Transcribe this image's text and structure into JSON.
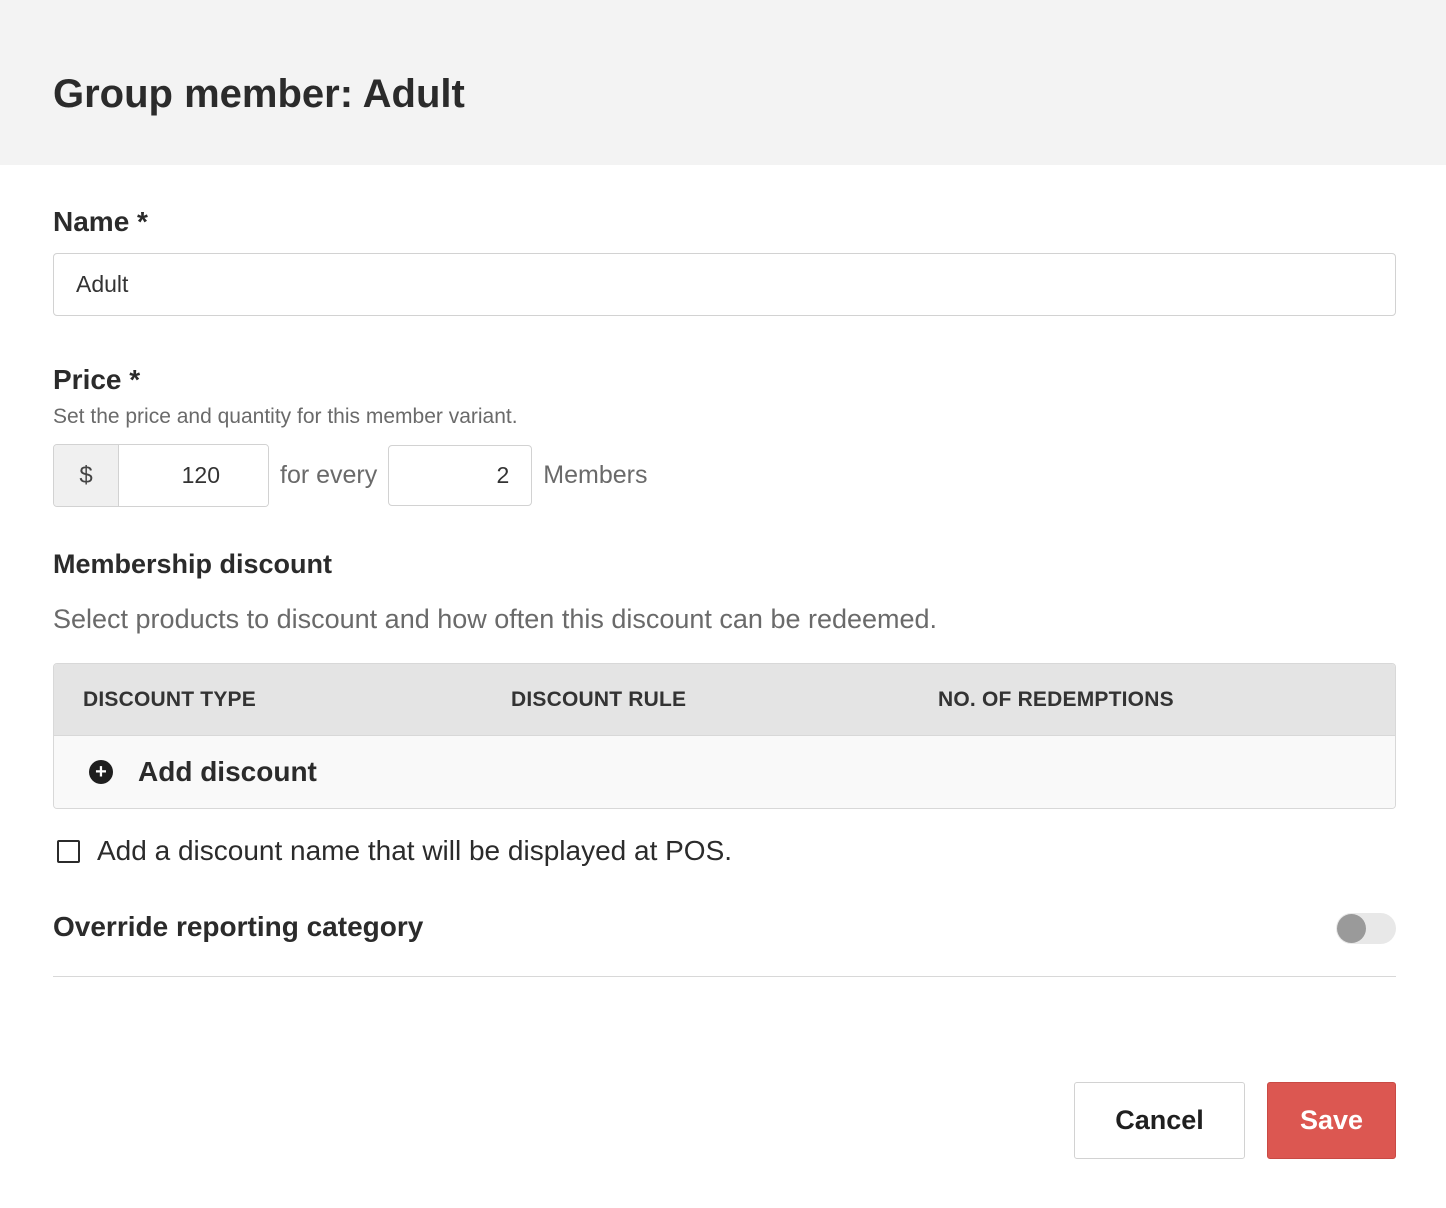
{
  "header": {
    "title": "Group member: Adult"
  },
  "name_field": {
    "label": "Name *",
    "value": "Adult"
  },
  "price": {
    "label": "Price *",
    "help": "Set the price and quantity for this member variant.",
    "currency_symbol": "$",
    "amount": "120",
    "connector": "for every",
    "quantity": "2",
    "unit": "Members"
  },
  "membership_discount": {
    "title": "Membership discount",
    "help": "Select products to discount and how often this discount can be redeemed.",
    "columns": [
      "DISCOUNT TYPE",
      "DISCOUNT RULE",
      "NO. OF REDEMPTIONS"
    ],
    "add_label": "Add discount",
    "add_icon": "plus-circle-icon"
  },
  "pos_name_option": {
    "label": "Add a discount name that will be displayed at POS.",
    "checked": false
  },
  "override_reporting": {
    "label": "Override reporting category",
    "enabled": false
  },
  "actions": {
    "cancel": "Cancel",
    "save": "Save"
  },
  "colors": {
    "header_bg": "#f3f3f3",
    "save_bg": "#dc5751",
    "table_header_bg": "#e4e4e4"
  }
}
